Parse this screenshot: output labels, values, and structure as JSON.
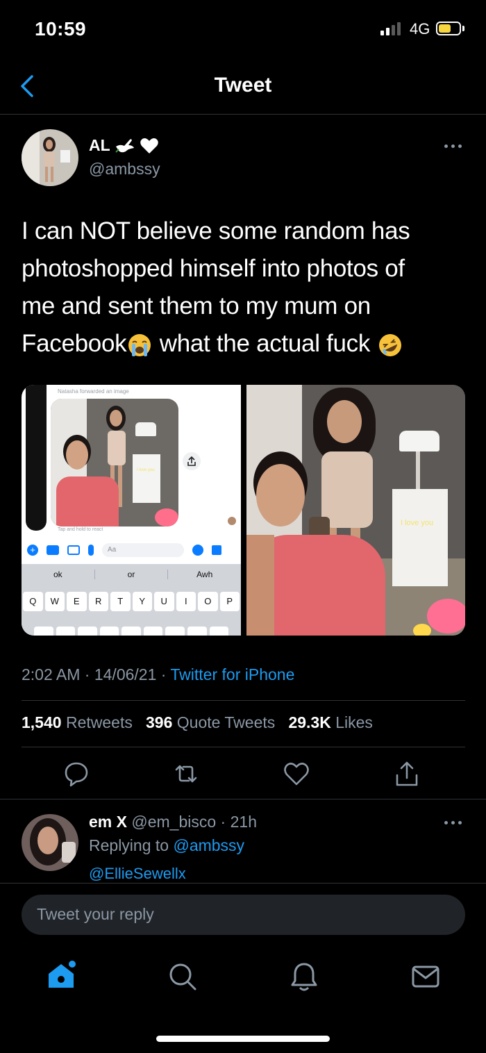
{
  "status_bar": {
    "time": "10:59",
    "network": "4G"
  },
  "header": {
    "title": "Tweet"
  },
  "tweet": {
    "author_name": "AL",
    "author_handle": "@ambssy",
    "text_line1": "I can NOT believe some random has",
    "text_line2": "photoshopped himself into photos of",
    "text_line3": "me and sent them to my mum on",
    "text_line4a": "Facebook",
    "text_line4b": " what the actual fuck ",
    "media": {
      "left": {
        "forward_note": "Natasha forwarded an image",
        "tap_hint": "Tap and hold to react",
        "compose_placeholder": "Aa",
        "suggestions": [
          "ok",
          "or",
          "Awh"
        ],
        "keyboard_row1": [
          "Q",
          "W",
          "E",
          "R",
          "T",
          "Y",
          "U",
          "I",
          "O",
          "P"
        ],
        "sticker_text": "I love you"
      },
      "right": {
        "sticker_text": "I love you"
      }
    },
    "time": "2:02 AM",
    "date": "14/06/21",
    "source": "Twitter for iPhone",
    "retweets_count": "1,540",
    "retweets_label": "Retweets",
    "quotes_count": "396",
    "quotes_label": "Quote Tweets",
    "likes_count": "29.3K",
    "likes_label": "Likes"
  },
  "reply": {
    "name": "em X",
    "handle": "@em_bisco",
    "age": "21h",
    "replying_to_label": "Replying to",
    "replying_to_handle": "@ambssy",
    "text": "@EllieSewellx"
  },
  "composer": {
    "placeholder": "Tweet your reply"
  },
  "colors": {
    "accent": "#1d9bf0",
    "background": "#000000",
    "muted": "#8b98a5",
    "divider": "#2f3336"
  },
  "icons": [
    "back-chevron-icon",
    "dove-icon",
    "heart-icon",
    "more-icon",
    "reply-icon",
    "retweet-icon",
    "like-icon",
    "share-icon",
    "home-icon",
    "search-icon",
    "notifications-icon",
    "messages-icon"
  ]
}
